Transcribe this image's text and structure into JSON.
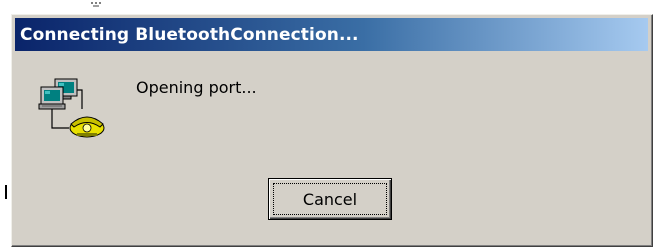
{
  "window": {
    "title": "Connecting BluetoothConnection..."
  },
  "dialog": {
    "message": "Opening port...",
    "icon": "network-connection-icon"
  },
  "buttons": {
    "cancel_label": "Cancel"
  },
  "colors": {
    "titlebar_start": "#0a246a",
    "titlebar_end": "#a6caf0",
    "dialog_face": "#d4d0c8"
  }
}
